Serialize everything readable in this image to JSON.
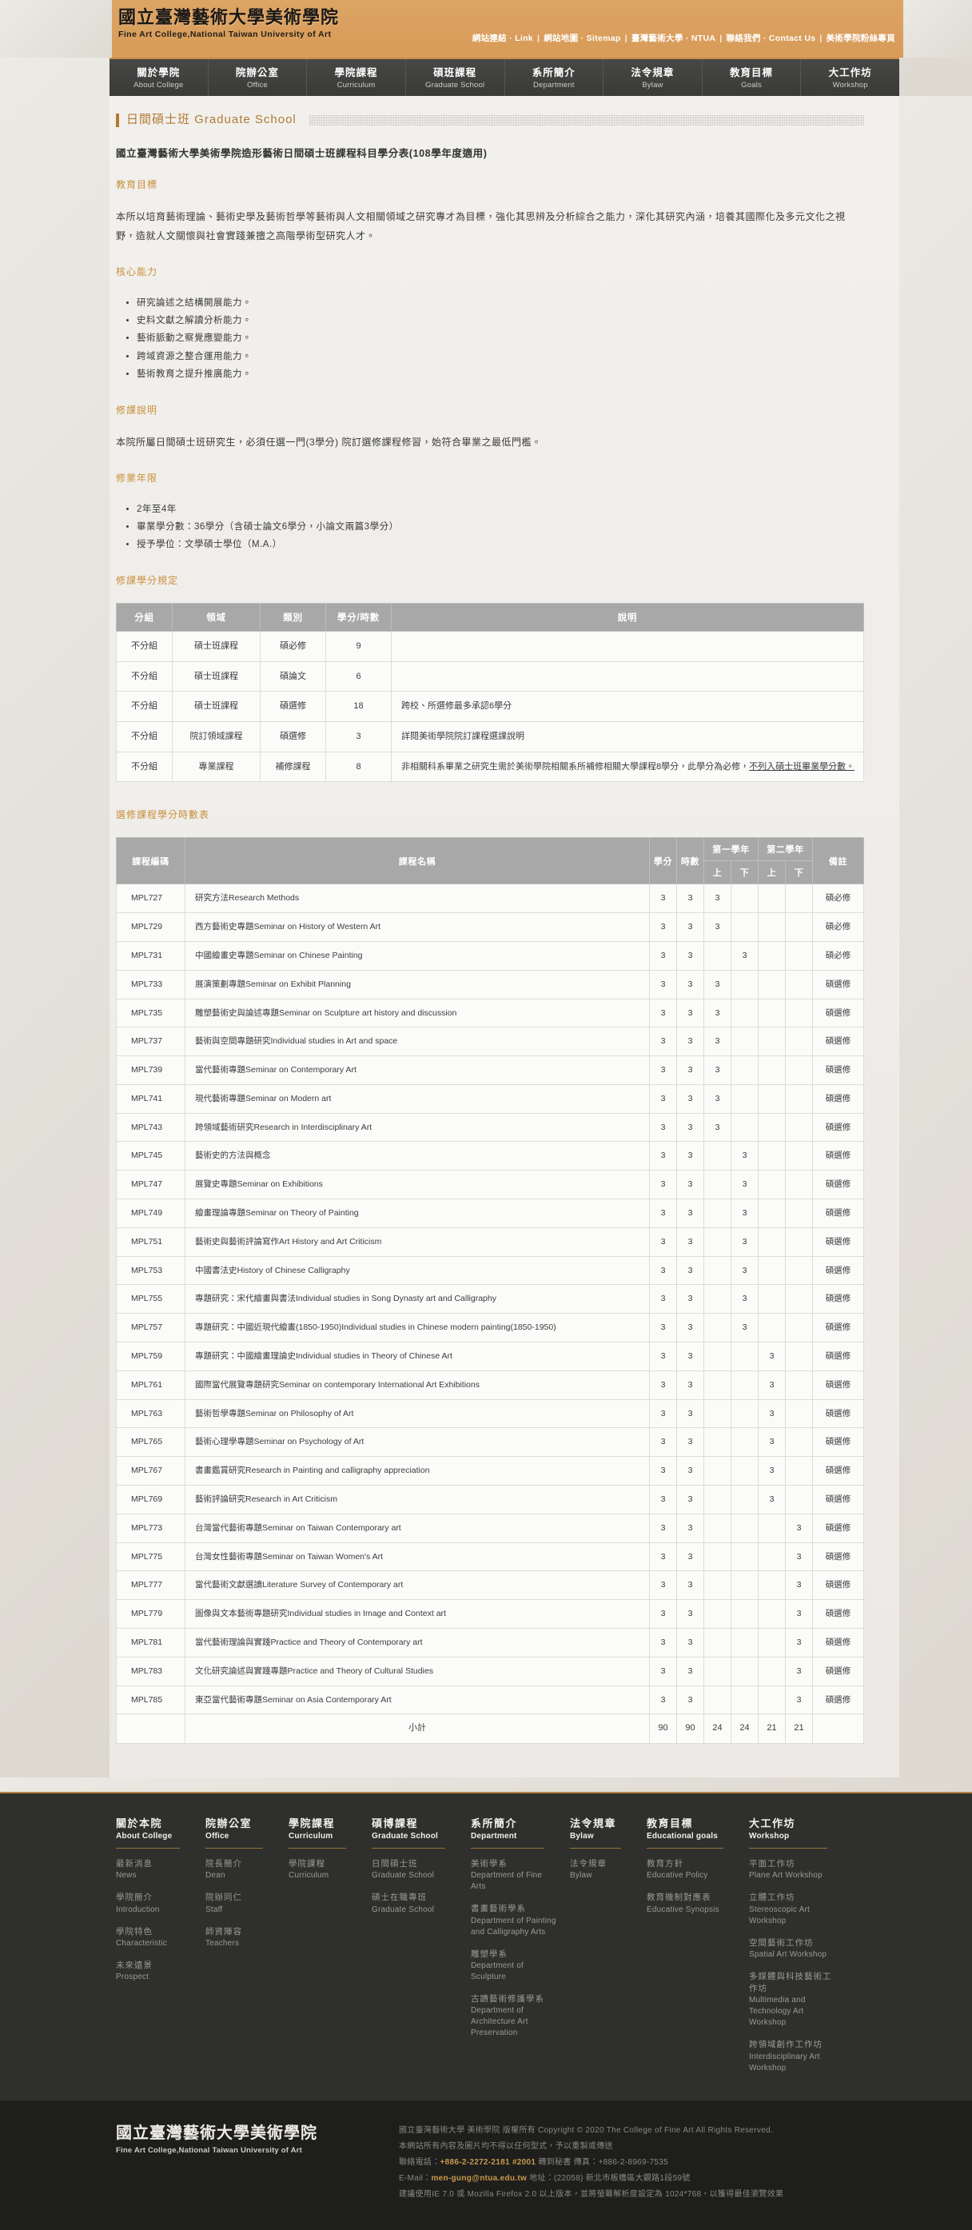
{
  "site": {
    "logo_cn": "國立臺灣藝術大學美術學院",
    "logo_en": "Fine Art College,National Taiwan University of Art",
    "toplinks": [
      {
        "cn": "網站連結",
        "en": "Link"
      },
      {
        "cn": "網站地圖",
        "en": "Sitemap"
      },
      {
        "cn": "臺灣藝術大學",
        "en": "NTUA"
      },
      {
        "cn": "聯絡我們",
        "en": "Contact Us"
      },
      {
        "cn": "美術學院粉絲專頁",
        "en": ""
      }
    ],
    "nav": [
      {
        "cn": "關於學院",
        "en": "About College"
      },
      {
        "cn": "院辦公室",
        "en": "Office"
      },
      {
        "cn": "學院課程",
        "en": "Curriculum"
      },
      {
        "cn": "碩班課程",
        "en": "Graduate School"
      },
      {
        "cn": "系所簡介",
        "en": "Department"
      },
      {
        "cn": "法令規章",
        "en": "Bylaw"
      },
      {
        "cn": "教育目標",
        "en": "Goals"
      },
      {
        "cn": "大工作坊",
        "en": "Workshop"
      }
    ]
  },
  "main": {
    "page_title": "日間碩士班 Graduate School",
    "doc_heading": "國立臺灣藝術大學美術學院造形藝術日間碩士班課程科目學分表(108學年度適用)",
    "sections": {
      "goals_head": "教育目標",
      "goals_body": "本所以培育藝術理論、藝術史學及藝術哲學等藝術與人文相關領域之研究專才為目標，強化其思辨及分析綜合之能力，深化其研究內涵，培養其國際化及多元文化之視野，造就人文關懷與社會實踐兼擅之高階學術型研究人才。",
      "core_head": "核心能力",
      "core_items": [
        "研究論述之結構開展能力。",
        "史料文獻之解讀分析能力。",
        "藝術脈動之察覺應變能力。",
        "跨域資源之整合運用能力。",
        "藝術教育之提升推廣能力。"
      ],
      "notes_head": "修課說明",
      "notes_body": "本院所屬日間碩士班研究生，必須任選一門(3學分) 院訂選修課程修習，始符合畢業之最低門檻。",
      "years_head": "修業年限",
      "years_items": [
        "2年至4年",
        "畢業學分數：36學分（含碩士論文6學分，小論文兩篇3學分）",
        "授予學位：文學碩士學位（M.A.）"
      ],
      "credits_head": "修課學分規定",
      "courses_head": "選修課程學分時數表"
    },
    "credit_table": {
      "headers": [
        "分組",
        "領域",
        "類別",
        "學分/時數",
        "說明"
      ],
      "rows": [
        {
          "group": "不分組",
          "field": "碩士班課程",
          "type": "碩必修",
          "credits": "9",
          "desc": "",
          "underline": ""
        },
        {
          "group": "不分組",
          "field": "碩士班課程",
          "type": "碩論文",
          "credits": "6",
          "desc": "",
          "underline": ""
        },
        {
          "group": "不分組",
          "field": "碩士班課程",
          "type": "碩選修",
          "credits": "18",
          "desc": "跨校、所選修最多承認6學分",
          "underline": ""
        },
        {
          "group": "不分組",
          "field": "院訂領域課程",
          "type": "碩選修",
          "credits": "3",
          "desc": "詳閱美術學院院訂課程選課說明",
          "underline": ""
        },
        {
          "group": "不分組",
          "field": "專業課程",
          "type": "補修課程",
          "credits": "8",
          "desc": "非相關科系畢業之研究生需於美術學院相關系所補修相關大學課程8學分，此學分為必修，",
          "underline": "不列入碩士班畢業學分數。"
        }
      ]
    },
    "course_table": {
      "headers": {
        "code": "課程編碼",
        "name": "課程名稱",
        "credits": "學分",
        "hours": "時數",
        "year1": "第一學年",
        "year2": "第二學年",
        "sem_up": "上",
        "sem_down": "下",
        "note": "備註"
      },
      "rows": [
        {
          "code": "MPL727",
          "name": "研究方法Research Methods",
          "credits": "3",
          "hours": "3",
          "y1u": "3",
          "y1d": "",
          "y2u": "",
          "y2d": "",
          "note": "碩必修"
        },
        {
          "code": "MPL729",
          "name": "西方藝術史專題Seminar on History of Western Art",
          "credits": "3",
          "hours": "3",
          "y1u": "3",
          "y1d": "",
          "y2u": "",
          "y2d": "",
          "note": "碩必修"
        },
        {
          "code": "MPL731",
          "name": "中國繪畫史專題Seminar on Chinese Painting",
          "credits": "3",
          "hours": "3",
          "y1u": "",
          "y1d": "3",
          "y2u": "",
          "y2d": "",
          "note": "碩必修"
        },
        {
          "code": "MPL733",
          "name": "展演策劃專題Seminar on Exhibit Planning",
          "credits": "3",
          "hours": "3",
          "y1u": "3",
          "y1d": "",
          "y2u": "",
          "y2d": "",
          "note": "碩選修"
        },
        {
          "code": "MPL735",
          "name": "雕塑藝術史與論述專題Seminar on Sculpture art history and discussion",
          "credits": "3",
          "hours": "3",
          "y1u": "3",
          "y1d": "",
          "y2u": "",
          "y2d": "",
          "note": "碩選修"
        },
        {
          "code": "MPL737",
          "name": "藝術與空間專題研究Individual studies in Art and space",
          "credits": "3",
          "hours": "3",
          "y1u": "3",
          "y1d": "",
          "y2u": "",
          "y2d": "",
          "note": "碩選修"
        },
        {
          "code": "MPL739",
          "name": "當代藝術專題Seminar on Contemporary Art",
          "credits": "3",
          "hours": "3",
          "y1u": "3",
          "y1d": "",
          "y2u": "",
          "y2d": "",
          "note": "碩選修"
        },
        {
          "code": "MPL741",
          "name": "現代藝術專題Seminar on Modern art",
          "credits": "3",
          "hours": "3",
          "y1u": "3",
          "y1d": "",
          "y2u": "",
          "y2d": "",
          "note": "碩選修"
        },
        {
          "code": "MPL743",
          "name": "跨領域藝術研究Research in Interdisciplinary Art",
          "credits": "3",
          "hours": "3",
          "y1u": "3",
          "y1d": "",
          "y2u": "",
          "y2d": "",
          "note": "碩選修"
        },
        {
          "code": "MPL745",
          "name": "藝術史的方法與概念",
          "credits": "3",
          "hours": "3",
          "y1u": "",
          "y1d": "3",
          "y2u": "",
          "y2d": "",
          "note": "碩選修"
        },
        {
          "code": "MPL747",
          "name": "展覽史專題Seminar on Exhibitions",
          "credits": "3",
          "hours": "3",
          "y1u": "",
          "y1d": "3",
          "y2u": "",
          "y2d": "",
          "note": "碩選修"
        },
        {
          "code": "MPL749",
          "name": "繪畫理論專題Seminar on Theory of Painting",
          "credits": "3",
          "hours": "3",
          "y1u": "",
          "y1d": "3",
          "y2u": "",
          "y2d": "",
          "note": "碩選修"
        },
        {
          "code": "MPL751",
          "name": "藝術史與藝術評論寫作Art History and Art Criticism",
          "credits": "3",
          "hours": "3",
          "y1u": "",
          "y1d": "3",
          "y2u": "",
          "y2d": "",
          "note": "碩選修"
        },
        {
          "code": "MPL753",
          "name": "中國書法史History of Chinese Calligraphy",
          "credits": "3",
          "hours": "3",
          "y1u": "",
          "y1d": "3",
          "y2u": "",
          "y2d": "",
          "note": "碩選修"
        },
        {
          "code": "MPL755",
          "name": "專題研究：宋代繪畫與書法Individual studies in Song Dynasty art and Calligraphy",
          "credits": "3",
          "hours": "3",
          "y1u": "",
          "y1d": "3",
          "y2u": "",
          "y2d": "",
          "note": "碩選修"
        },
        {
          "code": "MPL757",
          "name": "專題研究：中國近現代繪畫(1850-1950)Individual studies in Chinese modern painting(1850-1950)",
          "credits": "3",
          "hours": "3",
          "y1u": "",
          "y1d": "3",
          "y2u": "",
          "y2d": "",
          "note": "碩選修"
        },
        {
          "code": "MPL759",
          "name": "專題研究：中國繪畫理論史Individual studies in Theory of Chinese Art",
          "credits": "3",
          "hours": "3",
          "y1u": "",
          "y1d": "",
          "y2u": "3",
          "y2d": "",
          "note": "碩選修"
        },
        {
          "code": "MPL761",
          "name": "國際當代展覽專題研究Seminar on contemporary International Art Exhibitions",
          "credits": "3",
          "hours": "3",
          "y1u": "",
          "y1d": "",
          "y2u": "3",
          "y2d": "",
          "note": "碩選修"
        },
        {
          "code": "MPL763",
          "name": "藝術哲學專題Seminar on Philosophy of Art",
          "credits": "3",
          "hours": "3",
          "y1u": "",
          "y1d": "",
          "y2u": "3",
          "y2d": "",
          "note": "碩選修"
        },
        {
          "code": "MPL765",
          "name": "藝術心理學專題Seminar on Psychology of Art",
          "credits": "3",
          "hours": "3",
          "y1u": "",
          "y1d": "",
          "y2u": "3",
          "y2d": "",
          "note": "碩選修"
        },
        {
          "code": "MPL767",
          "name": "書畫鑑賞研究Research in Painting and calligraphy appreciation",
          "credits": "3",
          "hours": "3",
          "y1u": "",
          "y1d": "",
          "y2u": "3",
          "y2d": "",
          "note": "碩選修"
        },
        {
          "code": "MPL769",
          "name": "藝術評論研究Research in Art Criticism",
          "credits": "3",
          "hours": "3",
          "y1u": "",
          "y1d": "",
          "y2u": "3",
          "y2d": "",
          "note": "碩選修"
        },
        {
          "code": "MPL773",
          "name": "台灣當代藝術專題Seminar on Taiwan Contemporary art",
          "credits": "3",
          "hours": "3",
          "y1u": "",
          "y1d": "",
          "y2u": "",
          "y2d": "3",
          "note": "碩選修"
        },
        {
          "code": "MPL775",
          "name": "台灣女性藝術專題Seminar on Taiwan Women's Art",
          "credits": "3",
          "hours": "3",
          "y1u": "",
          "y1d": "",
          "y2u": "",
          "y2d": "3",
          "note": "碩選修"
        },
        {
          "code": "MPL777",
          "name": "當代藝術文獻選讀Literature Survey of Contemporary art",
          "credits": "3",
          "hours": "3",
          "y1u": "",
          "y1d": "",
          "y2u": "",
          "y2d": "3",
          "note": "碩選修"
        },
        {
          "code": "MPL779",
          "name": "圖像與文本藝術專題研究Individual studies in Image and Context art",
          "credits": "3",
          "hours": "3",
          "y1u": "",
          "y1d": "",
          "y2u": "",
          "y2d": "3",
          "note": "碩選修"
        },
        {
          "code": "MPL781",
          "name": "當代藝術理論與實踐Practice and Theory of Contemporary art",
          "credits": "3",
          "hours": "3",
          "y1u": "",
          "y1d": "",
          "y2u": "",
          "y2d": "3",
          "note": "碩選修"
        },
        {
          "code": "MPL783",
          "name": "文化研究論述與實踐專題Practice and Theory of Cultural Studies",
          "credits": "3",
          "hours": "3",
          "y1u": "",
          "y1d": "",
          "y2u": "",
          "y2d": "3",
          "note": "碩選修"
        },
        {
          "code": "MPL785",
          "name": "東亞當代藝術專題Seminar on Asia Contemporary Art",
          "credits": "3",
          "hours": "3",
          "y1u": "",
          "y1d": "",
          "y2u": "",
          "y2d": "3",
          "note": "碩選修"
        }
      ],
      "total": {
        "label": "小計",
        "credits": "90",
        "hours": "90",
        "y1u": "24",
        "y1d": "24",
        "y2u": "21",
        "y2d": "21",
        "note": ""
      }
    }
  },
  "footer": {
    "columns": [
      {
        "head_cn": "關於本院",
        "head_en": "About College",
        "links": [
          {
            "cn": "最新消息",
            "en": "News"
          },
          {
            "cn": "學院簡介",
            "en": "Introduction"
          },
          {
            "cn": "學院特色",
            "en": "Characteristic"
          },
          {
            "cn": "未來遠景",
            "en": "Prospect"
          }
        ]
      },
      {
        "head_cn": "院辦公室",
        "head_en": "Office",
        "links": [
          {
            "cn": "院長簡介",
            "en": "Dean"
          },
          {
            "cn": "院辦同仁",
            "en": "Staff"
          },
          {
            "cn": "師資陣容",
            "en": "Teachers"
          }
        ]
      },
      {
        "head_cn": "學院課程",
        "head_en": "Curriculum",
        "links": [
          {
            "cn": "學院課程",
            "en": "Curriculum"
          }
        ]
      },
      {
        "head_cn": "碩博課程",
        "head_en": "Graduate School",
        "links": [
          {
            "cn": "日間碩士班",
            "en": "Graduate School"
          },
          {
            "cn": "碩士在職專班",
            "en": "Graduate School"
          }
        ]
      },
      {
        "head_cn": "系所簡介",
        "head_en": "Department",
        "links": [
          {
            "cn": "美術學系",
            "en": "Department of Fine Arts"
          },
          {
            "cn": "書畫藝術學系",
            "en": "Department of Painting and Calligraphy Arts"
          },
          {
            "cn": "雕塑學系",
            "en": "Department of Sculpture"
          },
          {
            "cn": "古蹟藝術修護學系",
            "en": "Department of Architecture Art Preservation"
          }
        ]
      },
      {
        "head_cn": "法令規章",
        "head_en": "Bylaw",
        "links": [
          {
            "cn": "法令規章",
            "en": "Bylaw"
          }
        ]
      },
      {
        "head_cn": "教育目標",
        "head_en": "Educational goals",
        "links": [
          {
            "cn": "教育方針",
            "en": "Educative Policy"
          },
          {
            "cn": "教育機制對應表",
            "en": "Educative Synopsis"
          }
        ]
      },
      {
        "head_cn": "大工作坊",
        "head_en": "Workshop",
        "links": [
          {
            "cn": "平面工作坊",
            "en": "Plane Art Workshop"
          },
          {
            "cn": "立體工作坊",
            "en": "Stereoscopic Art Workshop"
          },
          {
            "cn": "空間藝術工作坊",
            "en": "Spatial Art Workshop"
          },
          {
            "cn": "多媒體與科技藝術工作坊",
            "en": "Multimedia and Technology Art Workshop"
          },
          {
            "cn": "跨領域創作工作坊",
            "en": "Interdisciplinary Art Workshop"
          }
        ]
      }
    ],
    "bottom": {
      "logo_cn": "國立臺灣藝術大學美術學院",
      "logo_en": "Fine Art College,National Taiwan University of Art",
      "copyright": "國立臺灣藝術大學 美術學院 版權所有 Copyright © 2020 The College of Fine Art All Rights Reserved.",
      "line2": "本網站所有內容及圖片均不得以任何型式，予以重製或傳送",
      "phone_label": "聯絡電話：",
      "phone": "+886-2-2272-2181 #2001",
      "phone_suffix": " 轉到秘書 傳真：+886-2-8969-7535",
      "email_label": "E-Mail：",
      "email": "men-gung@ntua.edu.tw",
      "address": " 地址：(22058) 新北市板橋區大觀路1段59號",
      "browser": "建議使用IE 7.0 或 Mozilla Firefox 2.0 以上版本，並將螢幕解析度設定為 1024*768，以獲得最佳瀏覽效果"
    }
  }
}
